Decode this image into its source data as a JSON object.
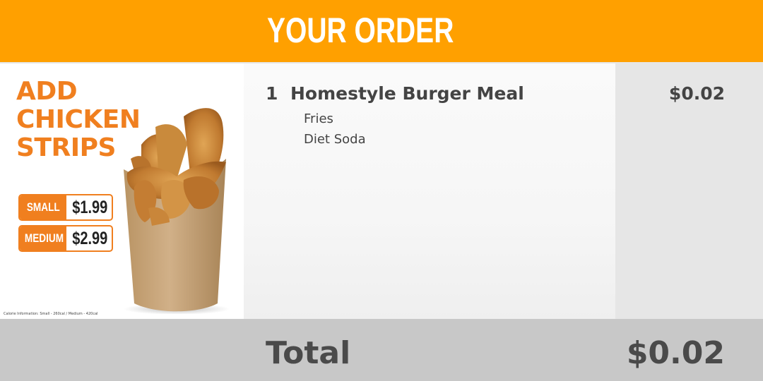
{
  "header": {
    "title": "YOUR ORDER"
  },
  "promo": {
    "headline": [
      "ADD",
      "CHICKEN",
      "STRIPS"
    ],
    "prices": [
      {
        "size": "SMALL",
        "price": "$1.99"
      },
      {
        "size": "MEDIUM",
        "price": "$2.99"
      }
    ],
    "calorie_note": "Calorie Information: Small - 260cal / Medium - 420cal",
    "accent_color": "#f07f1f"
  },
  "order": {
    "items": [
      {
        "qty": "1",
        "name": "Homestyle Burger Meal",
        "modifiers": [
          "Fries",
          "Diet Soda"
        ],
        "price": "$0.02"
      }
    ]
  },
  "footer": {
    "total_label": "Total",
    "total_value": "$0.02"
  },
  "colors": {
    "header_bg": "#ffa000",
    "footer_bg": "#c8c8c8",
    "price_column_bg": "#e6e6e6",
    "text": "#444444"
  }
}
